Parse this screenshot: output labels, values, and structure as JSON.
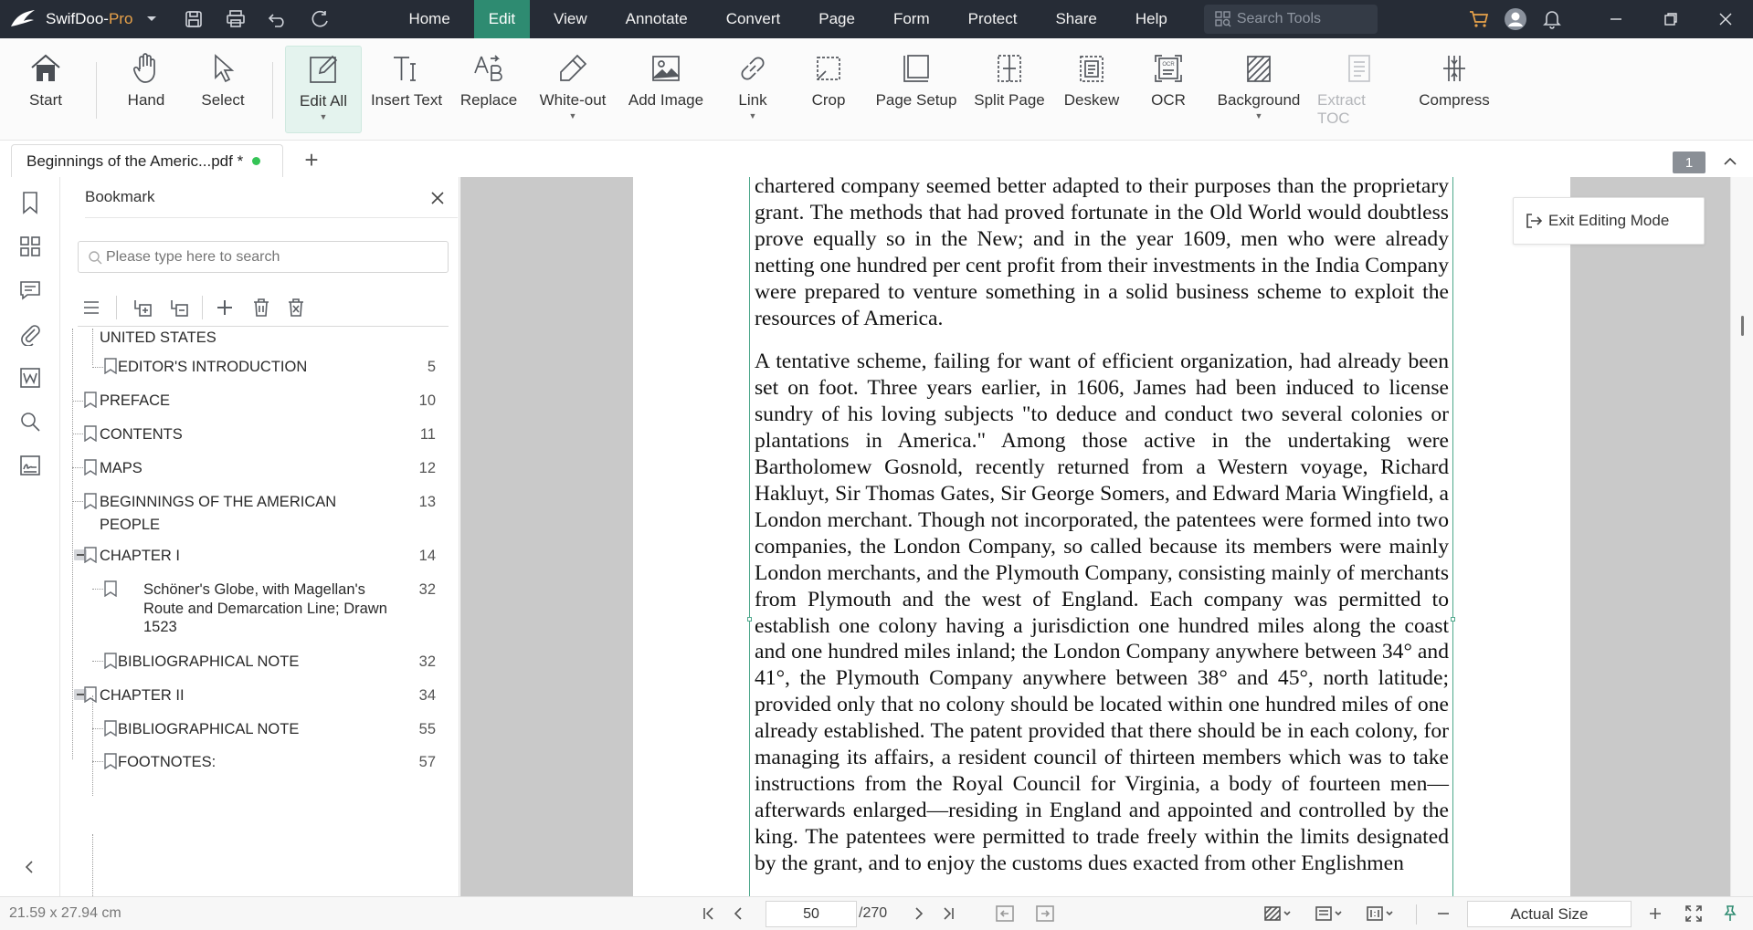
{
  "app": {
    "name": "SwifDoo-",
    "edition": "Pro"
  },
  "menu": {
    "items": [
      "Home",
      "Edit",
      "View",
      "Annotate",
      "Convert",
      "Page",
      "Form",
      "Protect",
      "Share",
      "Help"
    ],
    "active": "Edit",
    "search_placeholder": "Search Tools"
  },
  "ribbon": {
    "tools": [
      {
        "label": "Start",
        "icon": "house-icon"
      },
      {
        "label": "Hand",
        "icon": "hand-icon"
      },
      {
        "label": "Select",
        "icon": "cursor-icon"
      },
      {
        "label": "Edit All",
        "icon": "edit-square-icon",
        "selected": true,
        "dropdown": true
      },
      {
        "label": "Insert Text",
        "icon": "insert-text-icon"
      },
      {
        "label": "Replace",
        "icon": "replace-icon"
      },
      {
        "label": "White-out",
        "icon": "eraser-pen-icon",
        "dropdown": true
      },
      {
        "label": "Add Image",
        "icon": "image-icon"
      },
      {
        "label": "Link",
        "icon": "link-icon",
        "dropdown": true
      },
      {
        "label": "Crop",
        "icon": "crop-icon"
      },
      {
        "label": "Page Setup",
        "icon": "page-setup-icon"
      },
      {
        "label": "Split Page",
        "icon": "split-page-icon"
      },
      {
        "label": "Deskew",
        "icon": "deskew-icon"
      },
      {
        "label": "OCR",
        "icon": "ocr-icon"
      },
      {
        "label": "Background",
        "icon": "background-icon",
        "dropdown": true
      },
      {
        "label": "Extract TOC",
        "icon": "extract-toc-icon",
        "disabled": true
      },
      {
        "label": "Compress",
        "icon": "compress-icon"
      }
    ]
  },
  "tabs": {
    "document_title": "Beginnings of the Americ...pdf *",
    "add_label": "+",
    "open_count": "1"
  },
  "bookmark_panel": {
    "title": "Bookmark",
    "search_placeholder": "Please type here to search",
    "items": [
      {
        "label": "UNITED STATES",
        "page": ""
      },
      {
        "label": "EDITOR'S INTRODUCTION",
        "page": "5"
      },
      {
        "label": "PREFACE",
        "page": "10"
      },
      {
        "label": "CONTENTS",
        "page": "11"
      },
      {
        "label": "MAPS",
        "page": "12"
      },
      {
        "label": "BEGINNINGS OF THE AMERICAN PEOPLE",
        "page": "13"
      },
      {
        "label": "CHAPTER I",
        "page": "14"
      },
      {
        "label": "Schöner's Globe, with Magellan's Route and Demarcation Line; Drawn 1523",
        "page": "32"
      },
      {
        "label": "BIBLIOGRAPHICAL NOTE",
        "page": "32"
      },
      {
        "label": "CHAPTER II",
        "page": "34"
      },
      {
        "label": "BIBLIOGRAPHICAL NOTE",
        "page": "55"
      },
      {
        "label": "FOOTNOTES:",
        "page": "57"
      }
    ]
  },
  "document": {
    "paragraphs": [
      "chartered company seemed better adapted to their purposes than the proprietary grant. The methods that had proved fortunate in the Old World would doubtless prove equally so in the New; and in the year 1609, men who were already netting one hundred per cent profit from their investments in the India Company were prepared to venture something in a solid business scheme to exploit the resources of America.",
      "A tentative scheme, failing for want of efficient organization, had already been set on foot. Three years earlier, in 1606, James had been induced to license sundry of his loving subjects \"to deduce and conduct two several colonies or plantations in America.\" Among those active in the undertaking were Bartholomew Gosnold, recently returned from a Western voyage, Richard Hakluyt, Sir Thomas Gates, Sir George Somers, and Edward Maria Wingfield, a London merchant. Though not incorporated, the patentees were formed into two companies, the London Company, so called because its members were mainly London merchants, and the Plymouth Company, consisting mainly of merchants from Plymouth and the west of England. Each company was permitted to establish one colony having a jurisdiction one hundred miles along the coast and one hundred miles inland; the London Company anywhere between 34° and 41°, the Plymouth Company anywhere between 38° and 45°, north latitude; provided only that no colony should be located within one hundred miles of one already established. The patent provided that there should be in each colony, for managing its affairs, a resident council of thirteen members which was to take instructions from the Royal Council for Virginia, a body of fourteen men—afterwards enlarged—residing in England and appointed and controlled by the king. The patentees were permitted to trade freely within the limits designated by the grant, and to enjoy the customs dues exacted from other Englishmen"
    ],
    "exit_button": "Exit Editing Mode"
  },
  "status": {
    "page_dimensions": "21.59 x 27.94 cm",
    "current_page": "50",
    "total_pages": "/270",
    "zoom": "Actual Size"
  },
  "colors": {
    "titlebar": "#262c36",
    "accent": "#2e8b71",
    "pro": "#e8a24a"
  }
}
